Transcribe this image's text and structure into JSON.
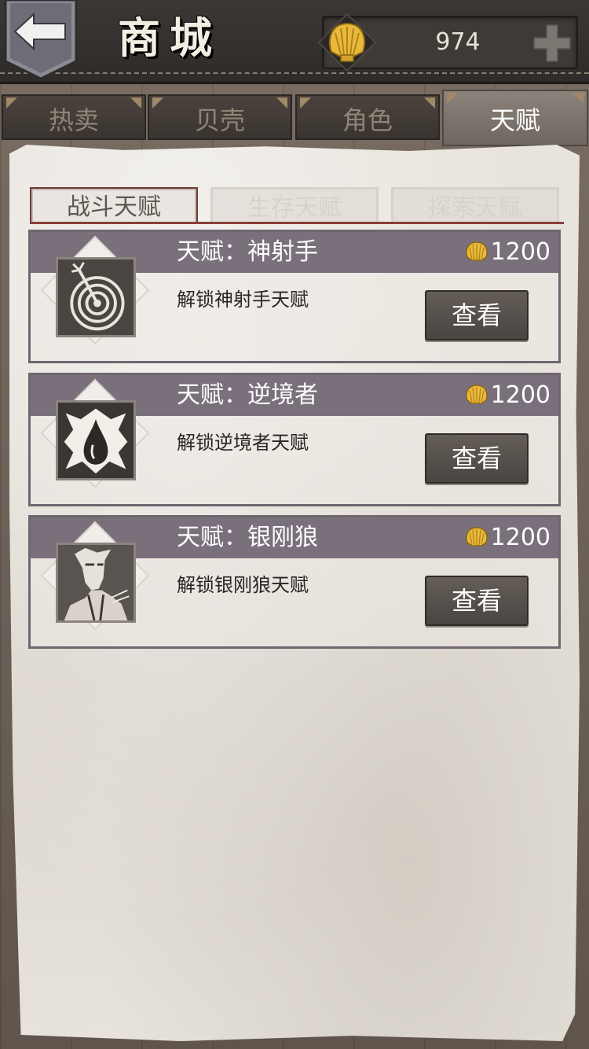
{
  "header": {
    "title": "商城",
    "currency_amount": "974"
  },
  "tabs": [
    {
      "label": "热卖",
      "active": false
    },
    {
      "label": "贝壳",
      "active": false
    },
    {
      "label": "角色",
      "active": false
    },
    {
      "label": "天赋",
      "active": true
    }
  ],
  "subtabs": [
    {
      "label": "战斗天赋",
      "active": true
    },
    {
      "label": "生存天赋",
      "active": false
    },
    {
      "label": "探索天赋",
      "active": false
    }
  ],
  "talents": [
    {
      "title": "天赋：神射手",
      "price": "1200",
      "description": "解锁神射手天赋",
      "button": "查看",
      "icon": "target-arrow-icon"
    },
    {
      "title": "天赋：逆境者",
      "price": "1200",
      "description": "解锁逆境者天赋",
      "button": "查看",
      "icon": "blood-drop-icon"
    },
    {
      "title": "天赋：银刚狼",
      "price": "1200",
      "description": "解锁银刚狼天赋",
      "button": "查看",
      "icon": "wolverine-portrait-icon"
    }
  ],
  "colors": {
    "card_header": "#7a707c",
    "subtab_accent": "#8a3e3a",
    "shell_gold": "#e8b93a"
  }
}
